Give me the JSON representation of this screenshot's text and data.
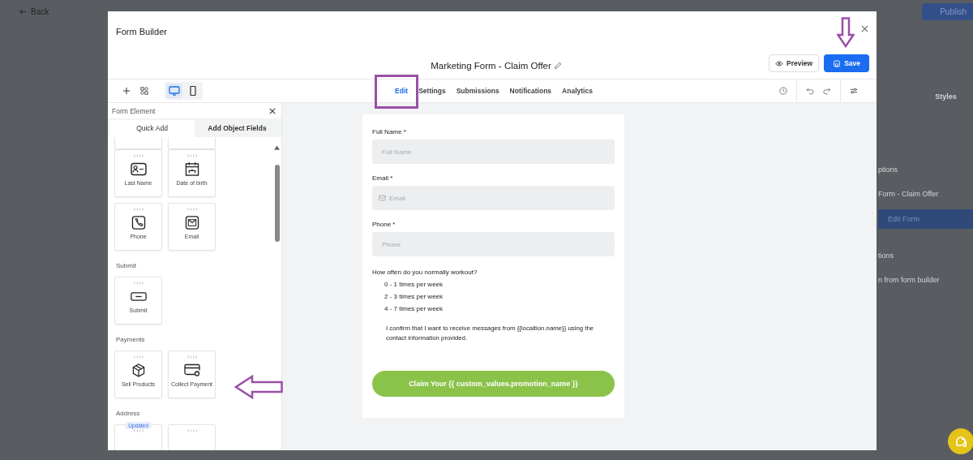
{
  "background": {
    "back_label": "Back",
    "publish_label": "Publish",
    "right_panel": {
      "tab": "Styles",
      "items": [
        {
          "kind": "heading",
          "text": "ptions"
        },
        {
          "kind": "select",
          "text": "Form - Claim Offer"
        },
        {
          "kind": "action",
          "text": "Edit Form"
        },
        {
          "kind": "heading",
          "text": "tions"
        },
        {
          "kind": "select",
          "text": "n from form builder"
        }
      ]
    }
  },
  "modal": {
    "title": "Form Builder",
    "form_name": "Marketing Form - Claim Offer",
    "preview_label": "Preview",
    "save_label": "Save",
    "devices": [
      {
        "kind": "desktop",
        "selected": true
      },
      {
        "kind": "mobile",
        "selected": false
      }
    ],
    "tabs": [
      {
        "label": "Edit",
        "selected": true
      },
      {
        "label": "Settings",
        "selected": false
      },
      {
        "label": "Submissions",
        "selected": false
      },
      {
        "label": "Notifications",
        "selected": false
      },
      {
        "label": "Analytics",
        "selected": false
      }
    ],
    "palette": {
      "title": "Form Element",
      "tabs": [
        {
          "label": "Quick Add",
          "selected": false
        },
        {
          "label": "Add Object Fields",
          "selected": true
        }
      ],
      "sections": [
        {
          "items": [
            {
              "kind": "partial"
            },
            {
              "kind": "partial"
            }
          ]
        },
        {
          "items": [
            {
              "kind": "contact-card",
              "label": "Last Name"
            },
            {
              "kind": "calendar",
              "label": "Date of birth"
            },
            {
              "kind": "phone",
              "label": "Phone"
            },
            {
              "kind": "mail",
              "label": "Email"
            }
          ]
        },
        {
          "title": "Submit",
          "items": [
            {
              "kind": "submit",
              "label": "Submit"
            }
          ]
        },
        {
          "title": "Payments",
          "items": [
            {
              "kind": "box",
              "label": "Sell Products"
            },
            {
              "kind": "card",
              "label": "Collect Payment"
            }
          ]
        },
        {
          "title": "Address",
          "items": [
            {
              "kind": "blank",
              "badge": "Updated"
            },
            {
              "kind": "blank"
            }
          ]
        }
      ]
    },
    "form": {
      "fields": [
        {
          "label": "Full Name *",
          "placeholder": "Full Name",
          "icon": false
        },
        {
          "label": "Email *",
          "placeholder": "Email",
          "icon": true
        },
        {
          "label": "Phone *",
          "placeholder": "Phone",
          "icon": false
        }
      ],
      "question": {
        "label": "How often do you normally workout?",
        "options": [
          "0 - 1 times per week",
          "2 - 3 times per week",
          "4 - 7 times per week"
        ]
      },
      "consent": "I confirm that I want to receive messages from {{localtion.name}} using the contact information provided.",
      "submit_label": "Claim Your {{ custom_values.promotion_name }}"
    }
  }
}
